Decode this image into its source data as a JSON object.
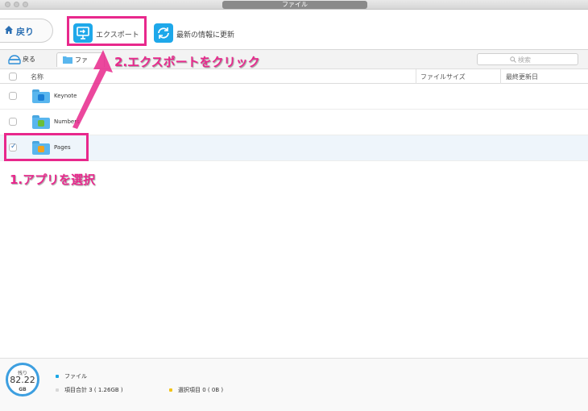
{
  "window": {
    "title": "ファイル"
  },
  "toolbar": {
    "back_label": "戻り",
    "export_label": "エクスポート",
    "refresh_label": "最新の情報に更新"
  },
  "nav": {
    "back_label": "戻る",
    "breadcrumb": "ファ",
    "search_placeholder": "検索"
  },
  "table": {
    "columns": {
      "name": "名称",
      "size": "ファイルサイズ",
      "modified": "最終更新日"
    },
    "rows": [
      {
        "name": "Keynote",
        "checked": false,
        "app_color": "#1b7fd6"
      },
      {
        "name": "Numbers",
        "checked": false,
        "app_color": "#6abf3a"
      },
      {
        "name": "Pages",
        "checked": true,
        "app_color": "#f2a21e"
      }
    ]
  },
  "annotations": {
    "step1": "1.アプリを選択",
    "step2": "2.エクスポートをクリック",
    "color": "#e8288c"
  },
  "footer": {
    "gauge_label": "残り",
    "gauge_value": "82.22",
    "gauge_unit": "GB",
    "legend_file": "ファイル",
    "total_items": "項目合計 3 ( 1.26GB )",
    "selected_items": "選択項目 0 ( 0B )",
    "legend_file_color": "#1aa7e6",
    "legend_total_color": "#d8d8d8",
    "legend_selected_color": "#f2c318"
  }
}
